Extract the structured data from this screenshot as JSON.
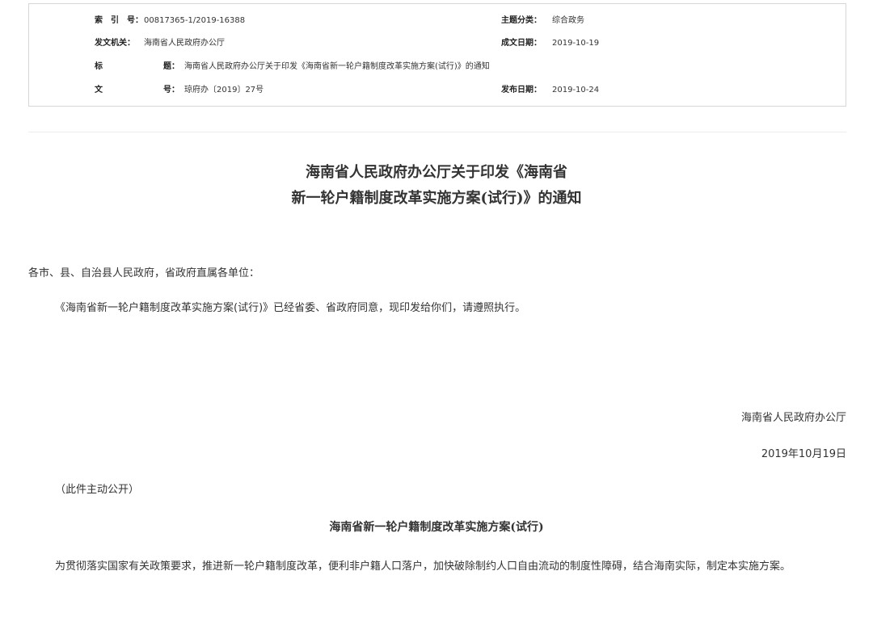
{
  "meta": {
    "index_label": "索　引　号：",
    "index_value": "00817365-1/2019-16388",
    "category_label": "主题分类：",
    "category_value": "综合政务",
    "issuer_label": "发文机关：",
    "issuer_value": "海南省人民政府办公厅",
    "created_label": "成文日期：",
    "created_value": "2019-10-19",
    "title_label_1": "标",
    "title_label_2": "题：",
    "title_value": "海南省人民政府办公厅关于印发《海南省新一轮户籍制度改革实施方案(试行)》的通知",
    "docno_label_1": "文",
    "docno_label_2": "号：",
    "docno_value": "琼府办〔2019〕27号",
    "published_label": "发布日期：",
    "published_value": "2019-10-24"
  },
  "document": {
    "title_line1": "海南省人民政府办公厅关于印发《海南省",
    "title_line2": "新一轮户籍制度改革实施方案(试行)》的通知",
    "salutation": "各市、县、自治县人民政府，省政府直属各单位：",
    "body1": "《海南省新一轮户籍制度改革实施方案(试行)》已经省委、省政府同意，现印发给你们，请遵照执行。",
    "signer": "海南省人民政府办公厅",
    "date": "2019年10月19日",
    "public_note": "（此件主动公开）",
    "sub_title": "海南省新一轮户籍制度改革实施方案(试行)",
    "body2": "为贯彻落实国家有关政策要求，推进新一轮户籍制度改革，便利非户籍人口落户，加快破除制约人口自由流动的制度性障碍，结合海南实际，制定本实施方案。"
  }
}
